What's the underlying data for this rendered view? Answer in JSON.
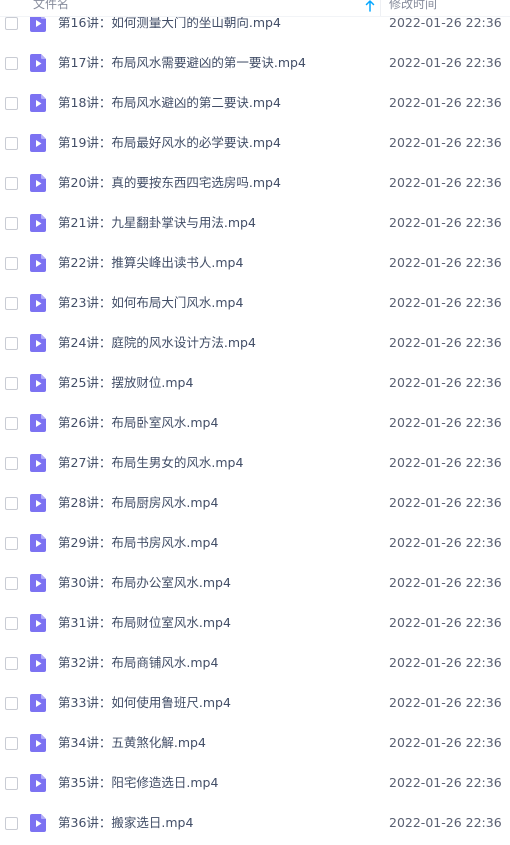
{
  "header": {
    "name_label": "文件名",
    "time_label": "修改时间",
    "sort_icon": "arrow-up-icon",
    "accent_color": "#06a7ff"
  },
  "file_icon": {
    "name": "video-file-icon",
    "color": "#7c72f2"
  },
  "files": [
    {
      "name": "第16讲：如何测量大门的坐山朝向.mp4",
      "date": "2022-01-26 22:36"
    },
    {
      "name": "第17讲：布局风水需要避凶的第一要诀.mp4",
      "date": "2022-01-26 22:36"
    },
    {
      "name": "第18讲：布局风水避凶的第二要诀.mp4",
      "date": "2022-01-26 22:36"
    },
    {
      "name": "第19讲：布局最好风水的必学要诀.mp4",
      "date": "2022-01-26 22:36"
    },
    {
      "name": "第20讲：真的要按东西四宅选房吗.mp4",
      "date": "2022-01-26 22:36"
    },
    {
      "name": "第21讲：九星翻卦掌诀与用法.mp4",
      "date": "2022-01-26 22:36"
    },
    {
      "name": "第22讲：推算尖峰出读书人.mp4",
      "date": "2022-01-26 22:36"
    },
    {
      "name": "第23讲：如何布局大门风水.mp4",
      "date": "2022-01-26 22:36"
    },
    {
      "name": "第24讲：庭院的风水设计方法.mp4",
      "date": "2022-01-26 22:36"
    },
    {
      "name": "第25讲：摆放财位.mp4",
      "date": "2022-01-26 22:36"
    },
    {
      "name": "第26讲：布局卧室风水.mp4",
      "date": "2022-01-26 22:36"
    },
    {
      "name": "第27讲：布局生男女的风水.mp4",
      "date": "2022-01-26 22:36"
    },
    {
      "name": "第28讲：布局厨房风水.mp4",
      "date": "2022-01-26 22:36"
    },
    {
      "name": "第29讲：布局书房风水.mp4",
      "date": "2022-01-26 22:36"
    },
    {
      "name": "第30讲：布局办公室风水.mp4",
      "date": "2022-01-26 22:36"
    },
    {
      "name": "第31讲：布局财位室风水.mp4",
      "date": "2022-01-26 22:36"
    },
    {
      "name": "第32讲：布局商铺风水.mp4",
      "date": "2022-01-26 22:36"
    },
    {
      "name": "第33讲：如何使用鲁班尺.mp4",
      "date": "2022-01-26 22:36"
    },
    {
      "name": "第34讲：五黄煞化解.mp4",
      "date": "2022-01-26 22:36"
    },
    {
      "name": "第35讲：阳宅修造选日.mp4",
      "date": "2022-01-26 22:36"
    },
    {
      "name": "第36讲：搬家选日.mp4",
      "date": "2022-01-26 22:36"
    }
  ]
}
